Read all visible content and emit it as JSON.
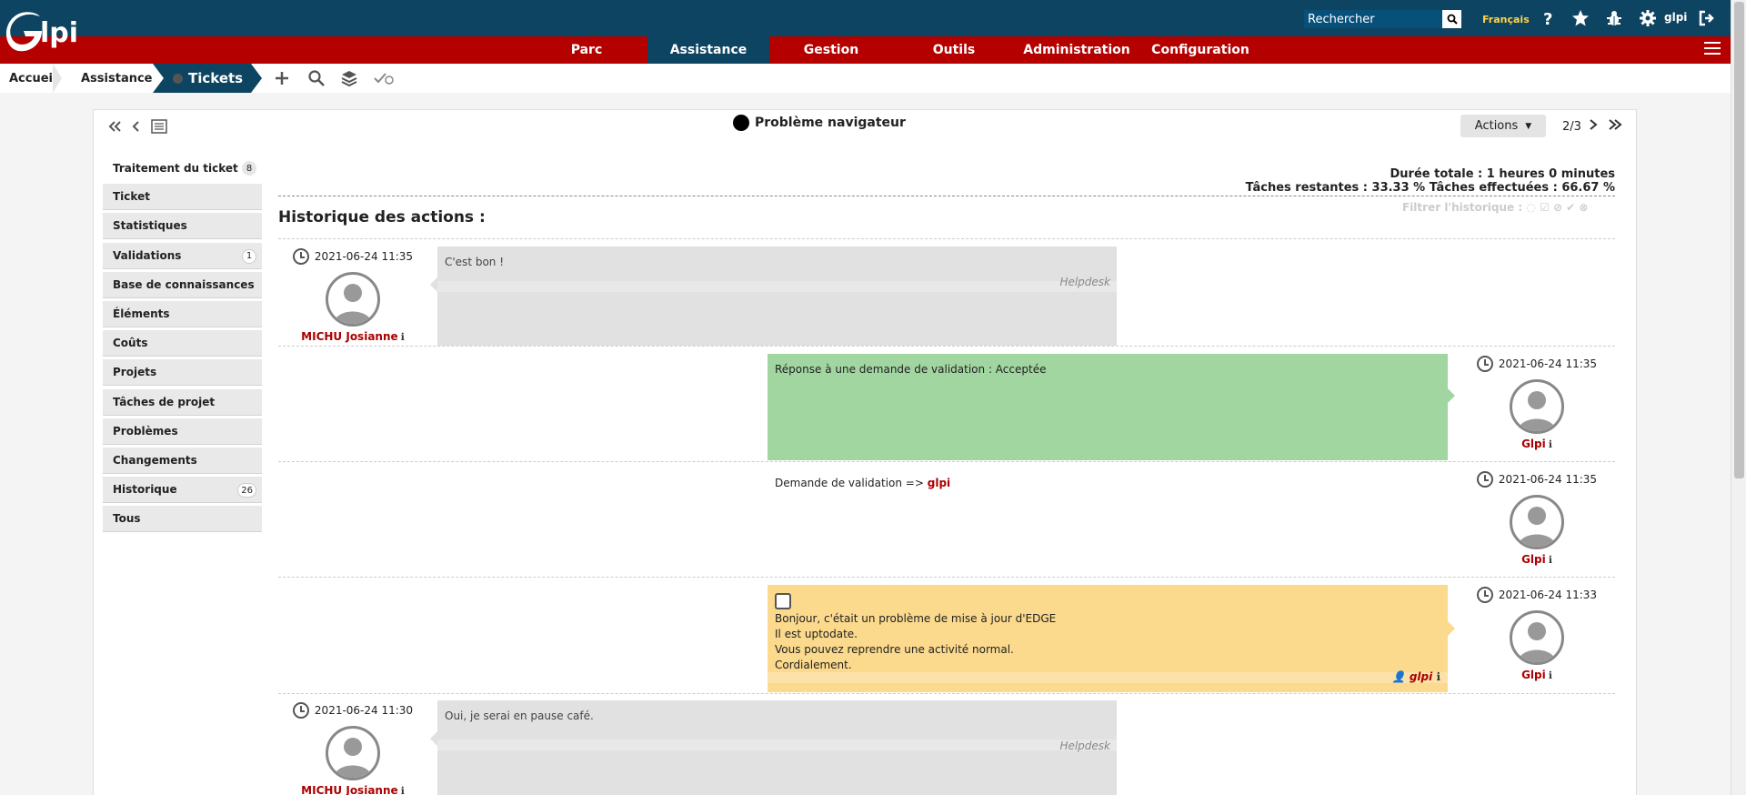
{
  "header": {
    "search_placeholder": "Rechercher",
    "language": "Français",
    "user": "glpi",
    "icons": [
      "help-icon",
      "star-icon",
      "bug-icon",
      "gear-icon",
      "logout-icon"
    ]
  },
  "menu": {
    "items": [
      {
        "label": "Parc"
      },
      {
        "label": "Assistance",
        "active": true
      },
      {
        "label": "Gestion"
      },
      {
        "label": "Outils"
      },
      {
        "label": "Administration"
      },
      {
        "label": "Configuration"
      }
    ]
  },
  "breadcrumb": {
    "home": "Accueil",
    "section": "Assistance",
    "current": "Tickets"
  },
  "ticket": {
    "title": "Problème navigateur",
    "actions_label": "Actions",
    "pager": "2/3"
  },
  "sidebar": {
    "items": [
      {
        "label": "Traitement du ticket",
        "badge": "8",
        "active": true
      },
      {
        "label": "Ticket"
      },
      {
        "label": "Statistiques"
      },
      {
        "label": "Validations",
        "badge": "1"
      },
      {
        "label": "Base de connaissances"
      },
      {
        "label": "Éléments"
      },
      {
        "label": "Coûts"
      },
      {
        "label": "Projets"
      },
      {
        "label": "Tâches de projet"
      },
      {
        "label": "Problèmes"
      },
      {
        "label": "Changements"
      },
      {
        "label": "Historique",
        "badge": "26"
      },
      {
        "label": "Tous"
      }
    ]
  },
  "summary": {
    "duration": "Durée totale : 1 heures 0 minutes",
    "tasks": "Tâches restantes : 33.33 % Tâches effectuées : 66.67 %",
    "filter_label": "Filtrer l'historique :",
    "history_title": "Historique des actions :"
  },
  "timeline": [
    {
      "side": "left",
      "date": "2021-06-24 11:35",
      "author": "MICHU Josianne",
      "text": "C'est bon !",
      "source": "Helpdesk",
      "kind": "followup"
    },
    {
      "side": "right",
      "date": "2021-06-24 11:35",
      "author": "Glpi",
      "text": "Réponse à une demande de validation : Acceptée",
      "kind": "validation-answer"
    },
    {
      "side": "right",
      "date": "2021-06-24 11:35",
      "author": "Glpi",
      "text_prefix": "Demande de validation =>",
      "text_user": "glpi",
      "kind": "validation-request"
    },
    {
      "side": "right",
      "date": "2021-06-24 11:33",
      "author": "Glpi",
      "lines": [
        "Bonjour, c'était un problème de mise à jour d'EDGE",
        "Il est uptodate.",
        "Vous pouvez reprendre une activité normal.",
        "Cordialement."
      ],
      "task_user": "glpi",
      "kind": "task"
    },
    {
      "side": "left",
      "date": "2021-06-24 11:30",
      "author": "MICHU Josianne",
      "text": "Oui, je serai en pause café.",
      "source": "Helpdesk",
      "kind": "followup"
    }
  ],
  "colors": {
    "topbar": "#0d4461",
    "menubar": "#b50000",
    "followup": "#e1e1e1",
    "validation": "#a2d6a1",
    "task": "#fbd98d",
    "author": "#aa0000"
  }
}
